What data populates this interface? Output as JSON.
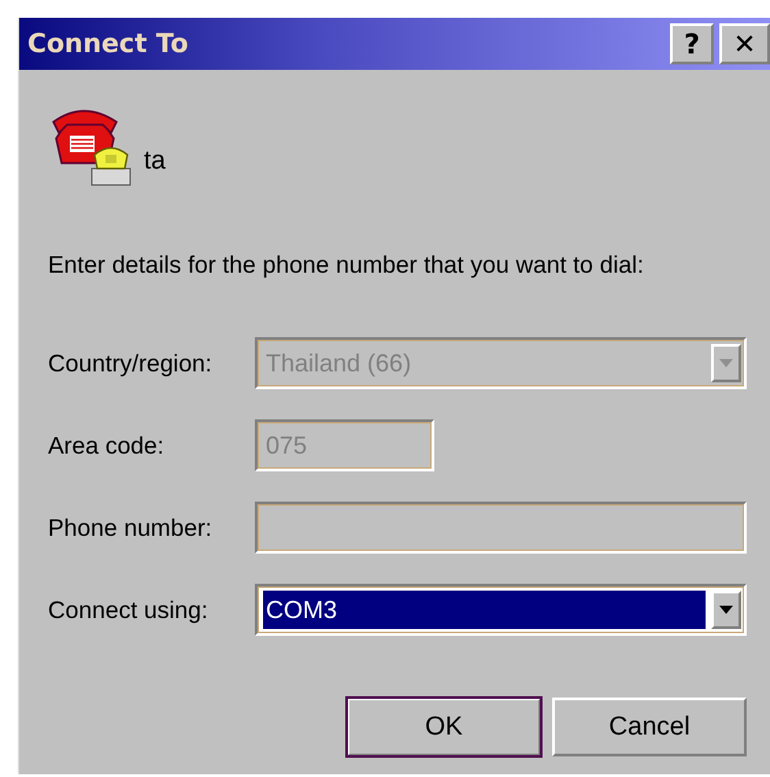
{
  "window": {
    "title": "Connect To",
    "help_button": "?",
    "close_button": "✕"
  },
  "connection": {
    "name": "ta"
  },
  "prompt": "Enter details for the phone number that you want to dial:",
  "fields": [
    {
      "label": "Country/region:",
      "kind": "dropdown",
      "value": "Thailand (66)",
      "disabled": true,
      "highlighted": false
    },
    {
      "label": "Area code:",
      "kind": "short-text",
      "value": "075",
      "disabled": true
    },
    {
      "label": "Phone number:",
      "kind": "text",
      "disabled": true
    },
    {
      "label": "Connect using:",
      "kind": "dropdown",
      "value": "COM3",
      "disabled": false,
      "highlighted": true
    }
  ],
  "buttons": [
    {
      "label": "OK",
      "default": true
    },
    {
      "label": "Cancel",
      "default": false
    }
  ]
}
